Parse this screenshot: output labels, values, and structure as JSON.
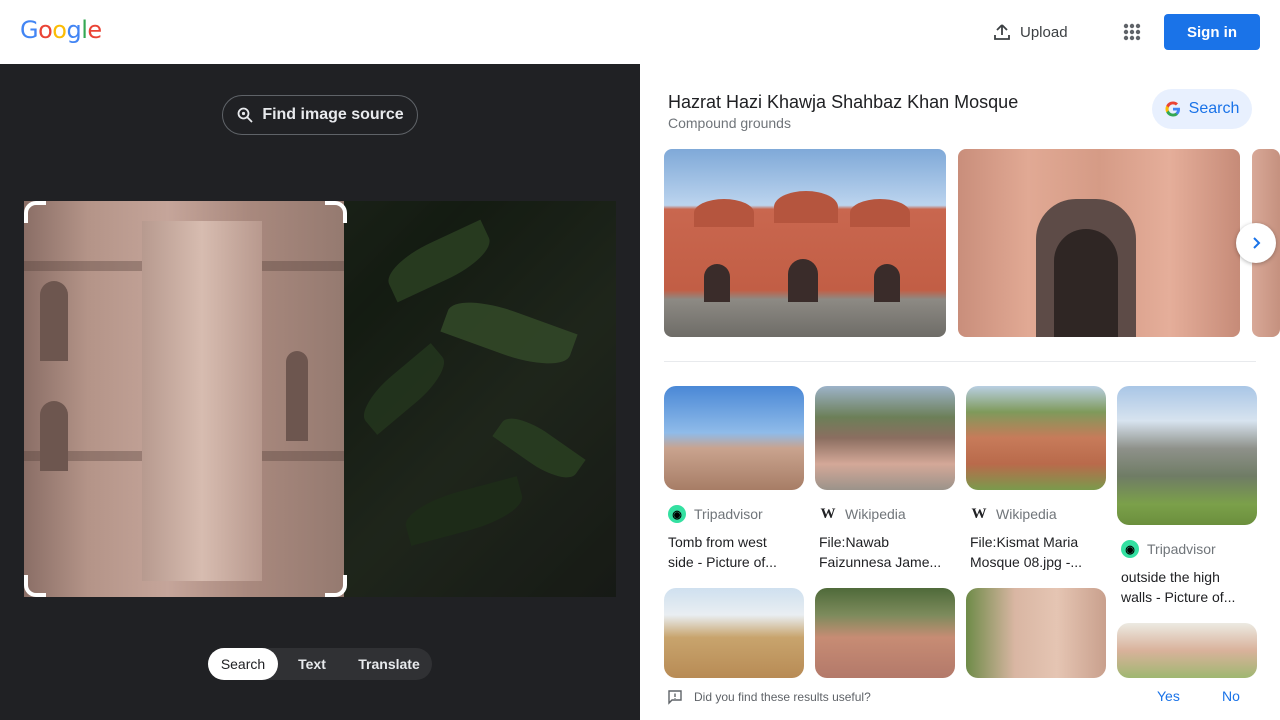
{
  "header": {
    "logo_letters": [
      "G",
      "o",
      "o",
      "g",
      "l",
      "e"
    ],
    "upload_label": "Upload",
    "apps_icon": "apps-grid-icon",
    "signin_label": "Sign in"
  },
  "lens": {
    "find_source_label": "Find image source",
    "modes": [
      {
        "label": "Search",
        "active": true
      },
      {
        "label": "Text",
        "active": false
      },
      {
        "label": "Translate",
        "active": false
      }
    ]
  },
  "knowledge": {
    "title": "Hazrat Hazi Khawja Shahbaz Khan Mosque",
    "subtitle": "Compound grounds",
    "search_label": "Search"
  },
  "results": [
    {
      "source": "Tripadvisor",
      "source_icon": "tripadvisor-icon",
      "title_line1": "Tomb from west",
      "title_line2": "side - Picture of..."
    },
    {
      "source": "Wikipedia",
      "source_icon": "wikipedia-icon",
      "title_line1": "File:Nawab",
      "title_line2": "Faizunnesa Jame..."
    },
    {
      "source": "Wikipedia",
      "source_icon": "wikipedia-icon",
      "title_line1": "File:Kismat Maria",
      "title_line2": "Mosque 08.jpg -..."
    },
    {
      "source": "Tripadvisor",
      "source_icon": "tripadvisor-icon",
      "title_line1": "outside the high",
      "title_line2": "walls - Picture of..."
    }
  ],
  "feedback": {
    "question": "Did you find these results useful?",
    "yes_label": "Yes",
    "no_label": "No"
  },
  "colors": {
    "accent": "#1a73e8",
    "left_panel_bg": "#202124",
    "tripadvisor": "#34e0a1"
  }
}
